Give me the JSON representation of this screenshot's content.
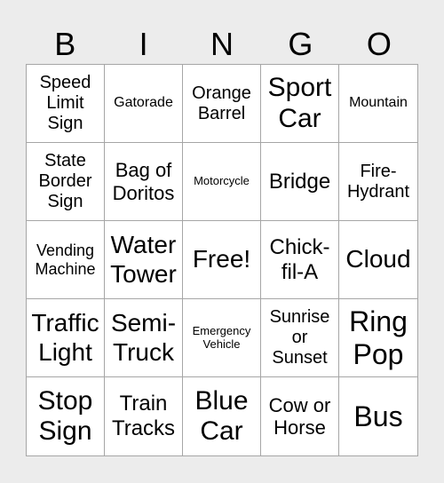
{
  "header": [
    "B",
    "I",
    "N",
    "G",
    "O"
  ],
  "cells": [
    "Speed Limit Sign",
    "Gatorade",
    "Orange Barrel",
    "Sport Car",
    "Mountain",
    "State Border Sign",
    "Bag of Doritos",
    "Motorcycle",
    "Bridge",
    "Fire-Hydrant",
    "Vending Machine",
    "Water Tower",
    "Free!",
    "Chick-fil-A",
    "Cloud",
    "Traffic Light",
    "Semi-Truck",
    "Emergency Vehicle",
    "Sunrise or Sunset",
    "Ring Pop",
    "Stop Sign",
    "Train Tracks",
    "Blue Car",
    "Cow or Horse",
    "Bus"
  ]
}
